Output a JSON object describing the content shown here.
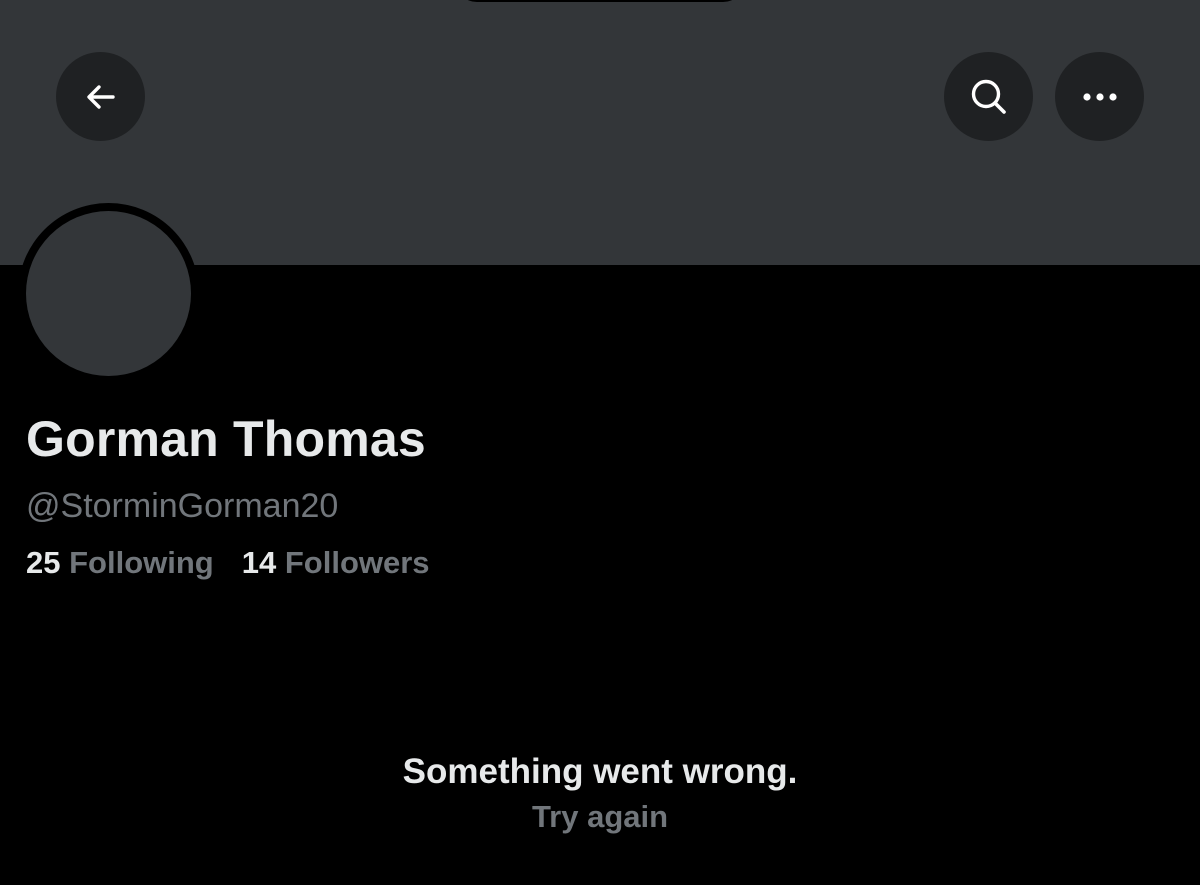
{
  "header": {
    "back_icon": "arrow-left-icon",
    "search_icon": "search-icon",
    "more_icon": "more-horizontal-icon"
  },
  "profile": {
    "display_name": "Gorman Thomas",
    "handle": "@StorminGorman20",
    "following_count": "25",
    "following_label": "Following",
    "followers_count": "14",
    "followers_label": "Followers"
  },
  "error": {
    "message": "Something went wrong.",
    "retry_label": "Try again"
  },
  "colors": {
    "background": "#000000",
    "banner": "#333639",
    "button_bg": "#1f2123",
    "primary_text": "#e7e9ea",
    "secondary_text": "#71767b"
  }
}
